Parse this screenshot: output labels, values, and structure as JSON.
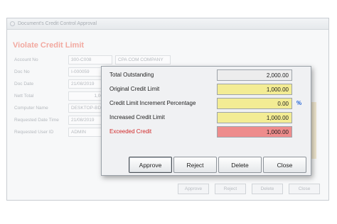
{
  "background_window": {
    "title": "Document's Credit Control Approval",
    "heading": "Violate Credit Limit",
    "fields": [
      {
        "label": "Account No",
        "value": "300-C008",
        "value2": "CPA COM COMPANY"
      },
      {
        "label": "Doc No",
        "value": "I-000059",
        "value2": ""
      },
      {
        "label": "Doc Date",
        "value": "21/08/2019",
        "value2": ""
      },
      {
        "label": "Nett Total",
        "value": "1,000.0",
        "value2": ""
      },
      {
        "label": "Computer Name",
        "value": "DESKTOP-BD1",
        "value2": ""
      },
      {
        "label": "Requested Date Time",
        "value": "21/08/2019",
        "value2": ""
      },
      {
        "label": "Requested User ID",
        "value": "ADMIN",
        "value2": ""
      }
    ],
    "buttons": {
      "approve": "Approve",
      "reject": "Reject",
      "delete": "Delete",
      "close": "Close"
    }
  },
  "dialog": {
    "rows": [
      {
        "label": "Total Outstanding",
        "value": "2,000.00",
        "style": "grey"
      },
      {
        "label": "Original Credit Limit",
        "value": "1,000.00",
        "style": "yellow"
      },
      {
        "label": "Credit Limit Increment Percentage",
        "value": "0.00",
        "style": "yellow",
        "suffix": "%"
      },
      {
        "label": "Increased Credit Limit",
        "value": "1,000.00",
        "style": "yellow"
      },
      {
        "label": "Exceeded Credit",
        "value": "1,000.00",
        "style": "pink"
      }
    ],
    "buttons": {
      "approve": "Approve",
      "reject": "Reject",
      "delete": "Delete",
      "close": "Close"
    }
  },
  "colors": {
    "exceeded_label": "#d22b2b",
    "yellow_field": "#f3ec94",
    "pink_field": "#ee8c8c",
    "percent_sign": "#1b5fd6"
  }
}
